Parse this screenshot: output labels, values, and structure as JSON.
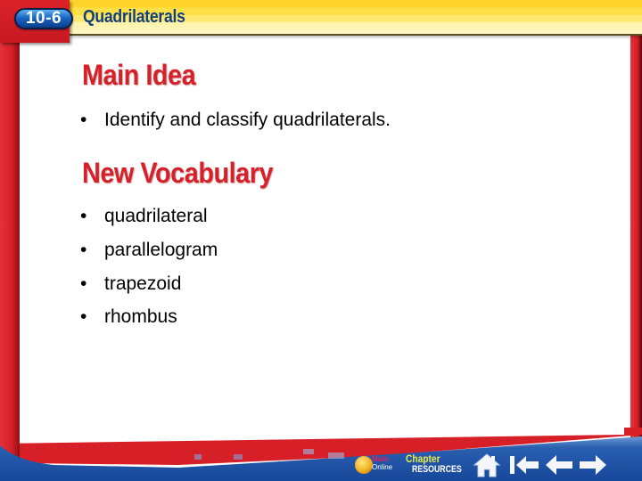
{
  "header": {
    "lesson_number": "10-6",
    "lesson_title": "Quadrilaterals"
  },
  "main_idea": {
    "heading": "Main Idea",
    "bullets": [
      "Identify and classify quadrilaterals."
    ]
  },
  "vocabulary": {
    "heading": "New Vocabulary",
    "bullets": [
      "quadrilateral",
      "parallelogram",
      "trapezoid",
      "rhombus"
    ]
  },
  "bullet_char": "•",
  "footer": {
    "math_online": {
      "line1": "Math",
      "line2": "Online",
      "icon": "globe-icon"
    },
    "chapter_resources": {
      "line1": "Chapter",
      "line2": "RESOURCES"
    },
    "nav": [
      {
        "name": "home",
        "icon": "home-icon"
      },
      {
        "name": "first",
        "icon": "first-slide-icon"
      },
      {
        "name": "back",
        "icon": "arrow-left-icon"
      },
      {
        "name": "next",
        "icon": "arrow-right-icon"
      }
    ]
  },
  "colors": {
    "accent_red": "#d6202a",
    "header_yellow": "#fed42a",
    "title_blue": "#123f7d",
    "footer_blue": "#1a4fa0"
  }
}
